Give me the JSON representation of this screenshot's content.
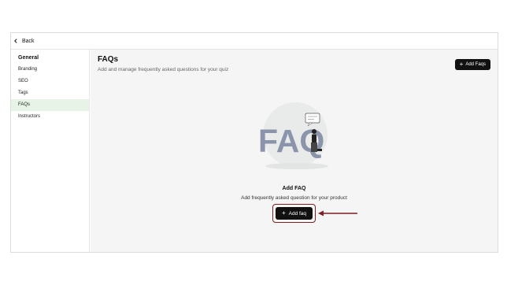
{
  "topbar": {
    "back_label": "Back"
  },
  "sidebar": {
    "heading": "General",
    "items": [
      {
        "label": "Branding"
      },
      {
        "label": "SEO"
      },
      {
        "label": "Tags"
      },
      {
        "label": "FAQs"
      },
      {
        "label": "Instructors"
      }
    ],
    "active_index": 3
  },
  "main": {
    "title": "FAQs",
    "subtitle": "Add and manage frequently asked questions for your quiz",
    "add_faqs_label": "Add Faqs",
    "illustration_text": "FAQ",
    "empty_state": {
      "title": "Add FAQ",
      "description": "Add frequently asked question for your product",
      "button_label": "Add faq"
    }
  },
  "colors": {
    "accent_active": "#e6f3e6",
    "button_bg": "#111111",
    "highlight": "#7a1f24",
    "faq_text": "#8a94aa"
  }
}
